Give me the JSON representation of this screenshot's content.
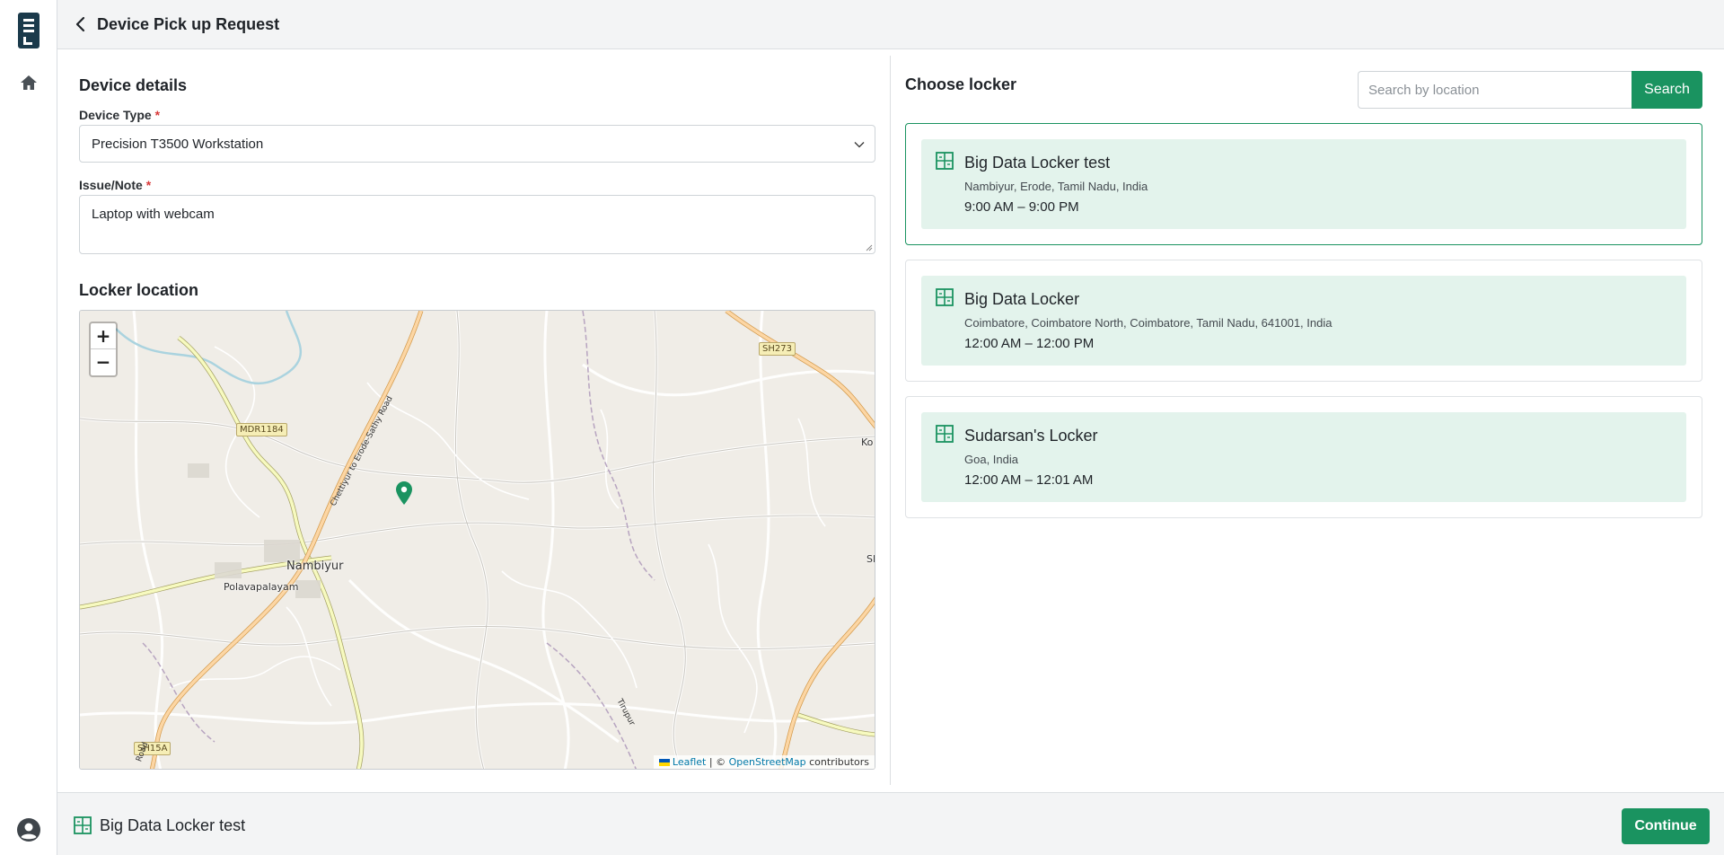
{
  "header": {
    "title": "Device Pick up Request"
  },
  "device_details": {
    "title": "Device details",
    "device_type_label": "Device Type",
    "device_type_value": "Precision T3500 Workstation",
    "issue_label": "Issue/Note",
    "issue_value": "Laptop with webcam",
    "required_mark": "*"
  },
  "map": {
    "title": "Locker location",
    "zoom_in": "+",
    "zoom_out": "−",
    "labels": {
      "town": "Nambiyur",
      "village": "Polavapalayam",
      "partial_east": "Ko",
      "partial_sh": "SI"
    },
    "shields": {
      "mdr": "MDR1184",
      "sh273": "SH273",
      "sh15a": "SH15A"
    },
    "road_names": {
      "sathy_road": "Chettiyur to Erode-Sathy Road",
      "tirupur_road": "Tirupur",
      "road_stub": "Road"
    },
    "attribution": {
      "leaflet": "Leaflet",
      "separator": " | © ",
      "osm": "OpenStreetMap",
      "suffix": " contributors"
    }
  },
  "choose_locker": {
    "title": "Choose locker",
    "search_placeholder": "Search by location",
    "search_button": "Search",
    "lockers": [
      {
        "name": "Big Data Locker test",
        "address": "Nambiyur, Erode, Tamil Nadu, India",
        "hours": "9:00 AM – 9:00 PM",
        "selected": true
      },
      {
        "name": "Big Data Locker",
        "address": "Coimbatore, Coimbatore North, Coimbatore, Tamil Nadu, 641001, India",
        "hours": "12:00 AM – 12:00 PM",
        "selected": false
      },
      {
        "name": "Sudarsan's Locker",
        "address": "Goa, India",
        "hours": "12:00 AM – 12:01 AM",
        "selected": false
      }
    ]
  },
  "footer": {
    "selected_locker": "Big Data Locker test",
    "continue_button": "Continue"
  },
  "colors": {
    "accent": "#1a9360",
    "card_bg": "#e3f3ec",
    "brand_dark": "#1b3a4b"
  },
  "icons": {
    "logo": "app-logo-icon",
    "home": "home-icon",
    "back": "chevron-left-icon",
    "profile": "user-circle-icon",
    "locker": "locker-icon",
    "marker": "map-marker-icon"
  }
}
